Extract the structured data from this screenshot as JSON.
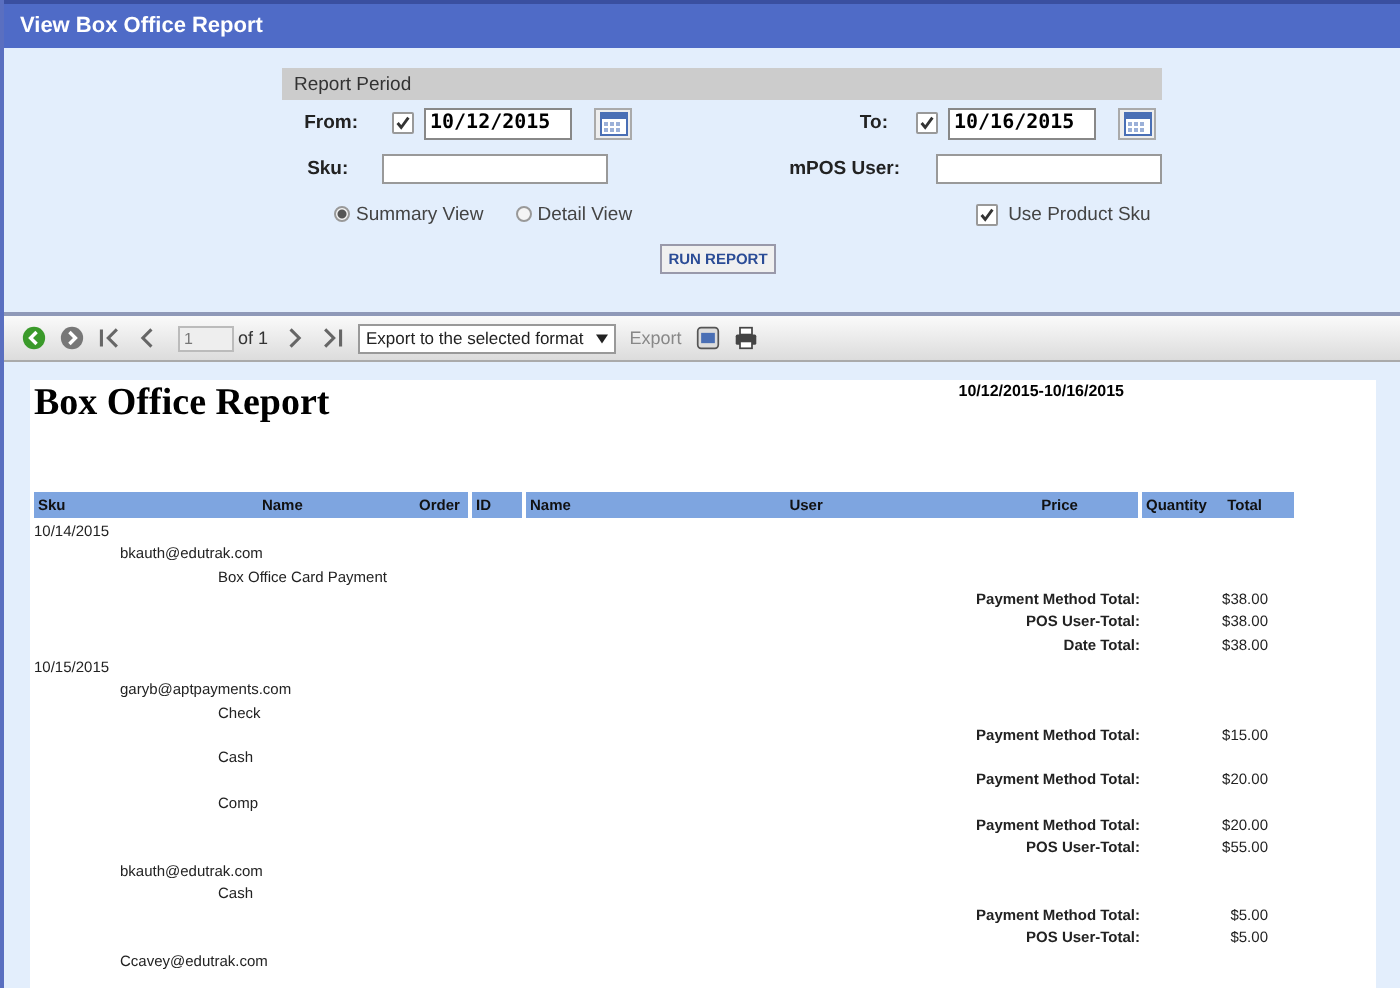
{
  "window": {
    "title": "View Box Office Report"
  },
  "report_period": {
    "title": "Report Period",
    "from": {
      "label": "From:",
      "checked": true,
      "value": "10/12/2015"
    },
    "to": {
      "label": "To:",
      "checked": true,
      "value": "10/16/2015"
    },
    "sku": {
      "label": "Sku:"
    },
    "mpos_user": {
      "label": "mPOS User:"
    },
    "views": [
      {
        "label": "Summary View",
        "selected": true
      },
      {
        "label": "Detail View",
        "selected": false
      }
    ],
    "use_product_sku": {
      "label": "Use Product Sku",
      "checked": true
    },
    "run_button": "RUN REPORT"
  },
  "toolbar": {
    "page": "1",
    "page_count": "of 1",
    "export_format": "Export to the selected format",
    "export_button": "Export"
  },
  "report": {
    "title": "Box Office Report",
    "date_range": "10/12/2015-10/16/2015",
    "column_groups": [
      [
        "Sku",
        "Name",
        "Order"
      ],
      [
        "ID"
      ],
      [
        "Name",
        "User",
        "Price"
      ],
      [
        "Quantity",
        "Total"
      ]
    ],
    "lines": [
      {
        "kind": "date",
        "text": "10/14/2015"
      },
      {
        "kind": "user",
        "text": "bkauth@edutrak.com"
      },
      {
        "kind": "method",
        "text": "Box Office Card Payment"
      },
      {
        "kind": "total",
        "label": "Payment Method Total:",
        "amount": "$38.00"
      },
      {
        "kind": "total",
        "label": "POS User-Total:",
        "amount": "$38.00"
      },
      {
        "kind": "total",
        "label": "Date Total:",
        "amount": "$38.00"
      },
      {
        "kind": "date",
        "text": "10/15/2015"
      },
      {
        "kind": "user",
        "text": "garyb@aptpayments.com"
      },
      {
        "kind": "method",
        "text": "Check"
      },
      {
        "kind": "total",
        "label": "Payment Method Total:",
        "amount": "$15.00"
      },
      {
        "kind": "method",
        "text": "Cash"
      },
      {
        "kind": "total",
        "label": "Payment Method Total:",
        "amount": "$20.00"
      },
      {
        "kind": "method",
        "text": "Comp"
      },
      {
        "kind": "total",
        "label": "Payment Method Total:",
        "amount": "$20.00"
      },
      {
        "kind": "total",
        "label": "POS User-Total:",
        "amount": "$55.00"
      },
      {
        "kind": "user",
        "text": "bkauth@edutrak.com"
      },
      {
        "kind": "method",
        "text": "Cash"
      },
      {
        "kind": "total",
        "label": "Payment Method Total:",
        "amount": "$5.00"
      },
      {
        "kind": "total",
        "label": "POS User-Total:",
        "amount": "$5.00"
      },
      {
        "kind": "user",
        "text": "Ccavey@edutrak.com"
      }
    ]
  }
}
